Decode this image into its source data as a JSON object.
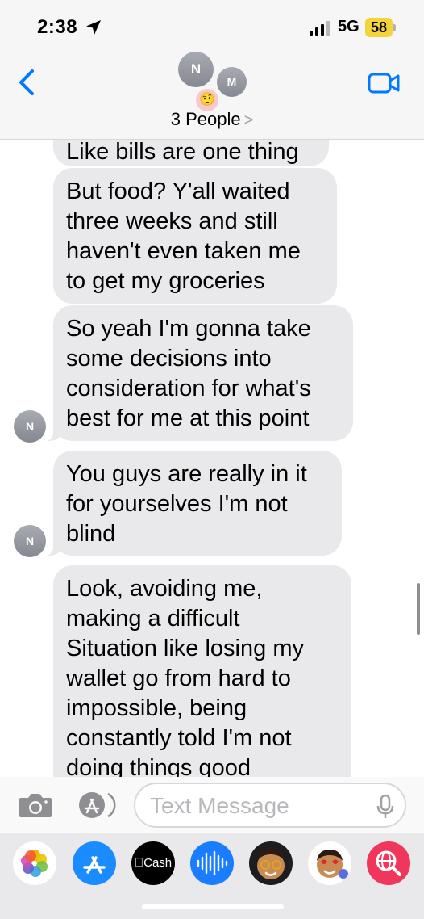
{
  "status_bar": {
    "time": "2:38",
    "network": "5G",
    "battery": "58"
  },
  "header": {
    "title": "3 People",
    "chevron": ">",
    "avatars": [
      "N",
      "M"
    ],
    "emoji": "🤨"
  },
  "messages": [
    {
      "sender": "N",
      "lines": [
        "Like bills are one thing"
      ]
    },
    {
      "sender": "N",
      "lines": [
        "But food? Y'all waited",
        "three weeks and still",
        "haven't even taken me",
        "to get my groceries"
      ]
    },
    {
      "sender": "N",
      "lines": [
        "So yeah I'm gonna take",
        "some decisions into",
        "consideration for what's",
        "best for me at this point"
      ]
    },
    {
      "sender": "N",
      "lines": [
        "You guys are really in it",
        "for yourselves I'm not",
        "blind"
      ]
    },
    {
      "sender": "N",
      "lines": [
        "Look, avoiding me,",
        "making a difficult",
        "Situation like losing my",
        "wallet go from hard to",
        "impossible, being",
        "constantly told I'm not",
        "doing things good"
      ]
    }
  ],
  "input": {
    "placeholder": "Text Message"
  },
  "app_drawer": {
    "apps": [
      {
        "name": "photos-app-icon",
        "label": ""
      },
      {
        "name": "app-store-icon",
        "label": ""
      },
      {
        "name": "apple-cash-icon",
        "label": "Cash"
      },
      {
        "name": "audio-message-icon",
        "label": ""
      },
      {
        "name": "memoji-icon",
        "label": ""
      },
      {
        "name": "memoji-stickers-icon",
        "label": ""
      },
      {
        "name": "web-images-icon",
        "label": ""
      }
    ]
  },
  "colors": {
    "accent": "#007aff",
    "bubble_received": "#e9e9eb",
    "avatar_gray": "#8e8e93"
  }
}
